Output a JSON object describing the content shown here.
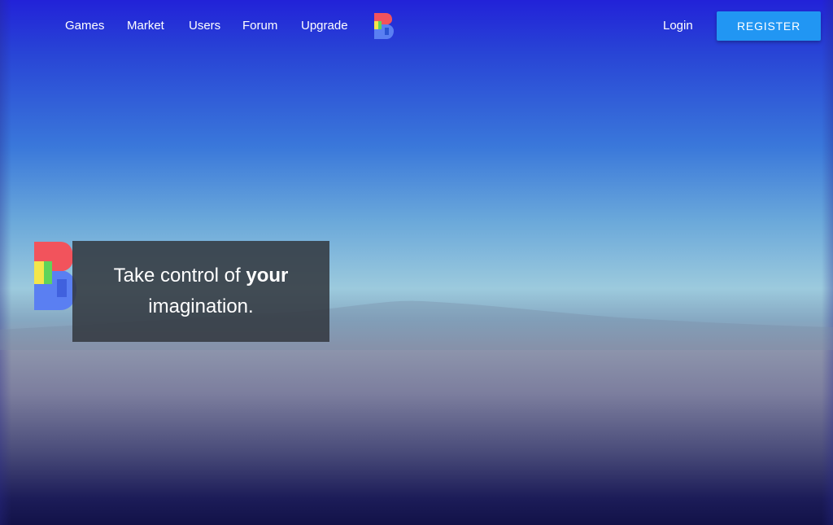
{
  "nav": {
    "links": [
      {
        "label": "Games"
      },
      {
        "label": "Market"
      },
      {
        "label": "Users"
      },
      {
        "label": "Forum"
      },
      {
        "label": "Upgrade"
      }
    ],
    "logo_icon": "letter-b-logo-icon",
    "login_label": "Login",
    "register_label": "REGISTER"
  },
  "hero": {
    "tagline_start": "Take control of ",
    "tagline_emphasis": "your",
    "tagline_end": "imagination.",
    "logo_icon": "letter-b-logo-icon"
  },
  "colors": {
    "register_button": "#2196f3",
    "logo_red": "#f2535c",
    "logo_green": "#5fd35a",
    "logo_yellow": "#f4e64a",
    "logo_blue": "#5a7ff2",
    "hero_box": "#32373e"
  }
}
